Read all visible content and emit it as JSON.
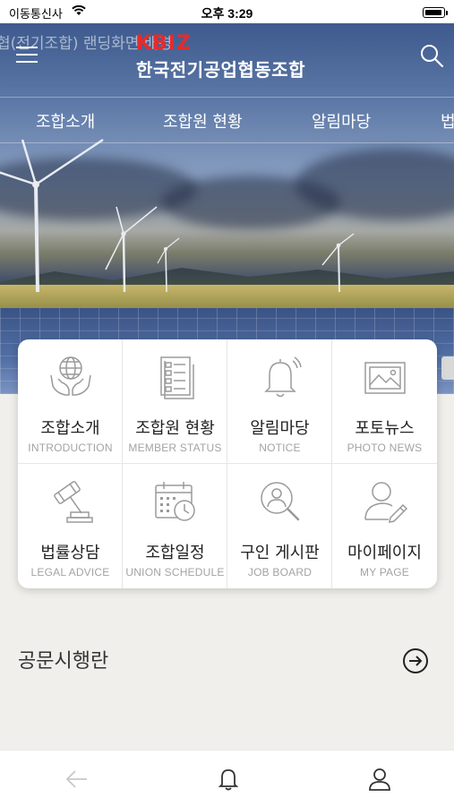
{
  "status_bar": {
    "carrier": "이동통신사",
    "time": "오후 3:29"
  },
  "header": {
    "ghost_text": "협(전기조합) 랜딩화면 배경",
    "logo_mark": "KBIZ",
    "logo_name": "한국전기공업협동조합"
  },
  "nav": {
    "items": [
      "조합소개",
      "조합원 현황",
      "알림마당",
      "법"
    ]
  },
  "menu": {
    "items": [
      {
        "label": "조합소개",
        "sublabel": "INTRODUCTION",
        "icon": "globe-hands-icon"
      },
      {
        "label": "조합원 현황",
        "sublabel": "MEMBER STATUS",
        "icon": "member-list-icon"
      },
      {
        "label": "알림마당",
        "sublabel": "NOTICE",
        "icon": "bell-icon"
      },
      {
        "label": "포토뉴스",
        "sublabel": "PHOTO NEWS",
        "icon": "photo-icon"
      },
      {
        "label": "법률상담",
        "sublabel": "LEGAL ADVICE",
        "icon": "gavel-icon"
      },
      {
        "label": "조합일정",
        "sublabel": "UNION SCHEDULE",
        "icon": "calendar-clock-icon"
      },
      {
        "label": "구인 게시판",
        "sublabel": "JOB BOARD",
        "icon": "search-person-icon"
      },
      {
        "label": "마이페이지",
        "sublabel": "MY PAGE",
        "icon": "user-edit-icon"
      }
    ]
  },
  "notice": {
    "title": "공문시행란"
  },
  "colors": {
    "brand_red": "#e52b2b",
    "icon_gray": "#9a9a9a",
    "background": "#f1efeb"
  }
}
